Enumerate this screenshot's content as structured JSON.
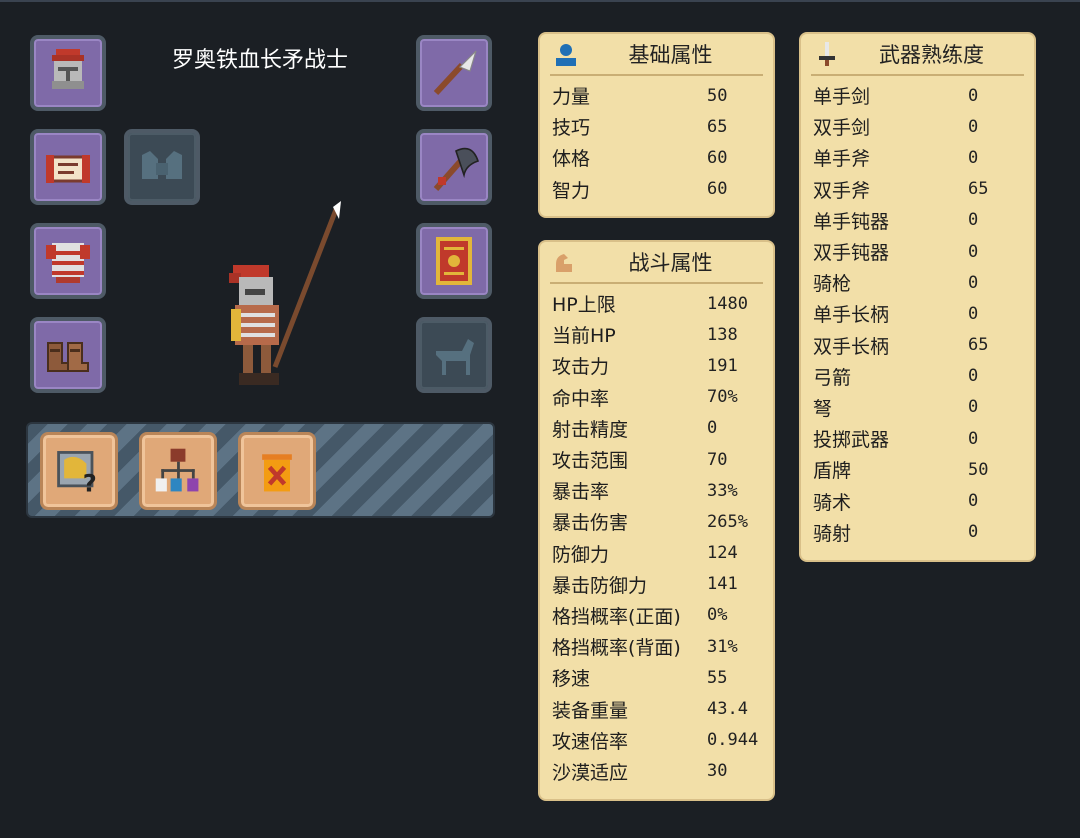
{
  "character": {
    "name": "罗奥铁血长矛战士"
  },
  "equipment_slots": {
    "left": [
      "helmet-icon",
      "scroll-icon",
      "armor-icon",
      "boots-icon"
    ],
    "left_empty": "gloves-icon",
    "right": [
      "spear-icon",
      "axe-icon",
      "shield-icon"
    ],
    "right_empty": "horse-icon"
  },
  "actions": [
    "unknown-item-icon",
    "skill-tree-icon",
    "dismiss-icon"
  ],
  "basic_attrs": {
    "title": "基础属性",
    "rows": [
      {
        "label": "力量",
        "value": "50"
      },
      {
        "label": "技巧",
        "value": "65"
      },
      {
        "label": "体格",
        "value": "60"
      },
      {
        "label": "智力",
        "value": "60"
      }
    ]
  },
  "combat_attrs": {
    "title": "战斗属性",
    "rows": [
      {
        "label": "HP上限",
        "value": "1480"
      },
      {
        "label": "当前HP",
        "value": "138"
      },
      {
        "label": "攻击力",
        "value": "191"
      },
      {
        "label": "命中率",
        "value": "70%"
      },
      {
        "label": "射击精度",
        "value": "0"
      },
      {
        "label": "攻击范围",
        "value": "70"
      },
      {
        "label": "暴击率",
        "value": "33%"
      },
      {
        "label": "暴击伤害",
        "value": "265%"
      },
      {
        "label": "防御力",
        "value": "124"
      },
      {
        "label": "暴击防御力",
        "value": "141"
      },
      {
        "label": "格挡概率(正面)",
        "value": "0%"
      },
      {
        "label": "格挡概率(背面)",
        "value": "31%"
      },
      {
        "label": "移速",
        "value": "55"
      },
      {
        "label": "装备重量",
        "value": "43.4"
      },
      {
        "label": "攻速倍率",
        "value": "0.944"
      },
      {
        "label": "沙漠适应",
        "value": "30"
      }
    ]
  },
  "weapon_prof": {
    "title": "武器熟练度",
    "rows": [
      {
        "label": "单手剑",
        "value": "0"
      },
      {
        "label": "双手剑",
        "value": "0"
      },
      {
        "label": "单手斧",
        "value": "0"
      },
      {
        "label": "双手斧",
        "value": "65"
      },
      {
        "label": "单手钝器",
        "value": "0"
      },
      {
        "label": "双手钝器",
        "value": "0"
      },
      {
        "label": "骑枪",
        "value": "0"
      },
      {
        "label": "单手长柄",
        "value": "0"
      },
      {
        "label": "双手长柄",
        "value": "65"
      },
      {
        "label": "弓箭",
        "value": "0"
      },
      {
        "label": "弩",
        "value": "0"
      },
      {
        "label": "投掷武器",
        "value": "0"
      },
      {
        "label": "盾牌",
        "value": "50"
      },
      {
        "label": "骑术",
        "value": "0"
      },
      {
        "label": "骑射",
        "value": "0"
      }
    ]
  }
}
